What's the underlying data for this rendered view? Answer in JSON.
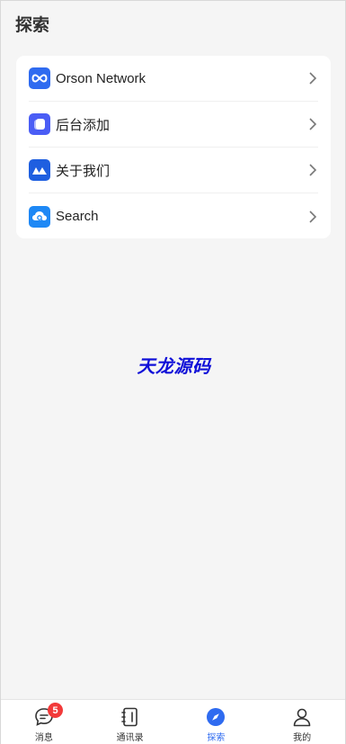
{
  "header": {
    "title": "探索"
  },
  "menu": {
    "items": [
      {
        "label": "Orson Network",
        "icon": "infinity-icon",
        "color": "#2f6bf0"
      },
      {
        "label": "后台添加",
        "icon": "rounded-square-icon",
        "color": "#4a5df5"
      },
      {
        "label": "关于我们",
        "icon": "mountain-logo-icon",
        "color": "#1f5fe0"
      },
      {
        "label": "Search",
        "icon": "cloud-search-icon",
        "color": "#1e88f5"
      }
    ]
  },
  "watermark": "天龙源码",
  "tabbar": {
    "items": [
      {
        "label": "消息",
        "icon": "chat-bubble-icon",
        "badge": "5"
      },
      {
        "label": "通讯录",
        "icon": "address-book-icon"
      },
      {
        "label": "探索",
        "icon": "compass-icon",
        "active": true
      },
      {
        "label": "我的",
        "icon": "person-icon"
      }
    ],
    "active_color": "#2f6bf0",
    "badge_color": "#f23a3a"
  }
}
